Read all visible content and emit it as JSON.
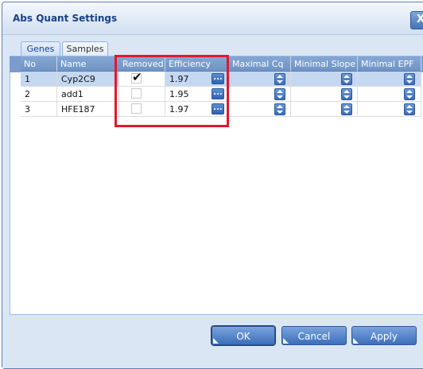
{
  "window": {
    "title": "Abs Quant Settings",
    "close_label": "X"
  },
  "tabs": [
    {
      "label": "Genes",
      "active": true
    },
    {
      "label": "Samples",
      "active": false
    }
  ],
  "grid": {
    "columns": [
      "No",
      "Name",
      "Removed",
      "Efficiency",
      "Maximal Cq",
      "Minimal Slope",
      "Minimal EPF"
    ],
    "rows": [
      {
        "no": "1",
        "name": "Cyp2C9",
        "removed": true,
        "efficiency": "1.97",
        "selected": true
      },
      {
        "no": "2",
        "name": "add1",
        "removed": false,
        "efficiency": "1.95",
        "selected": false
      },
      {
        "no": "3",
        "name": "HFE187",
        "removed": false,
        "efficiency": "1.97",
        "selected": false
      }
    ]
  },
  "buttons": {
    "ok": "OK",
    "cancel": "Cancel",
    "apply": "Apply"
  },
  "icons": {
    "check": "✔",
    "ellipsis": "...",
    "spin": "spin-up-down-icon"
  },
  "colors": {
    "header_blue": "#7a9dcc",
    "selection": "#c4d8f2",
    "highlight_red": "#e2172b",
    "button_blue": "#3c6fba"
  }
}
